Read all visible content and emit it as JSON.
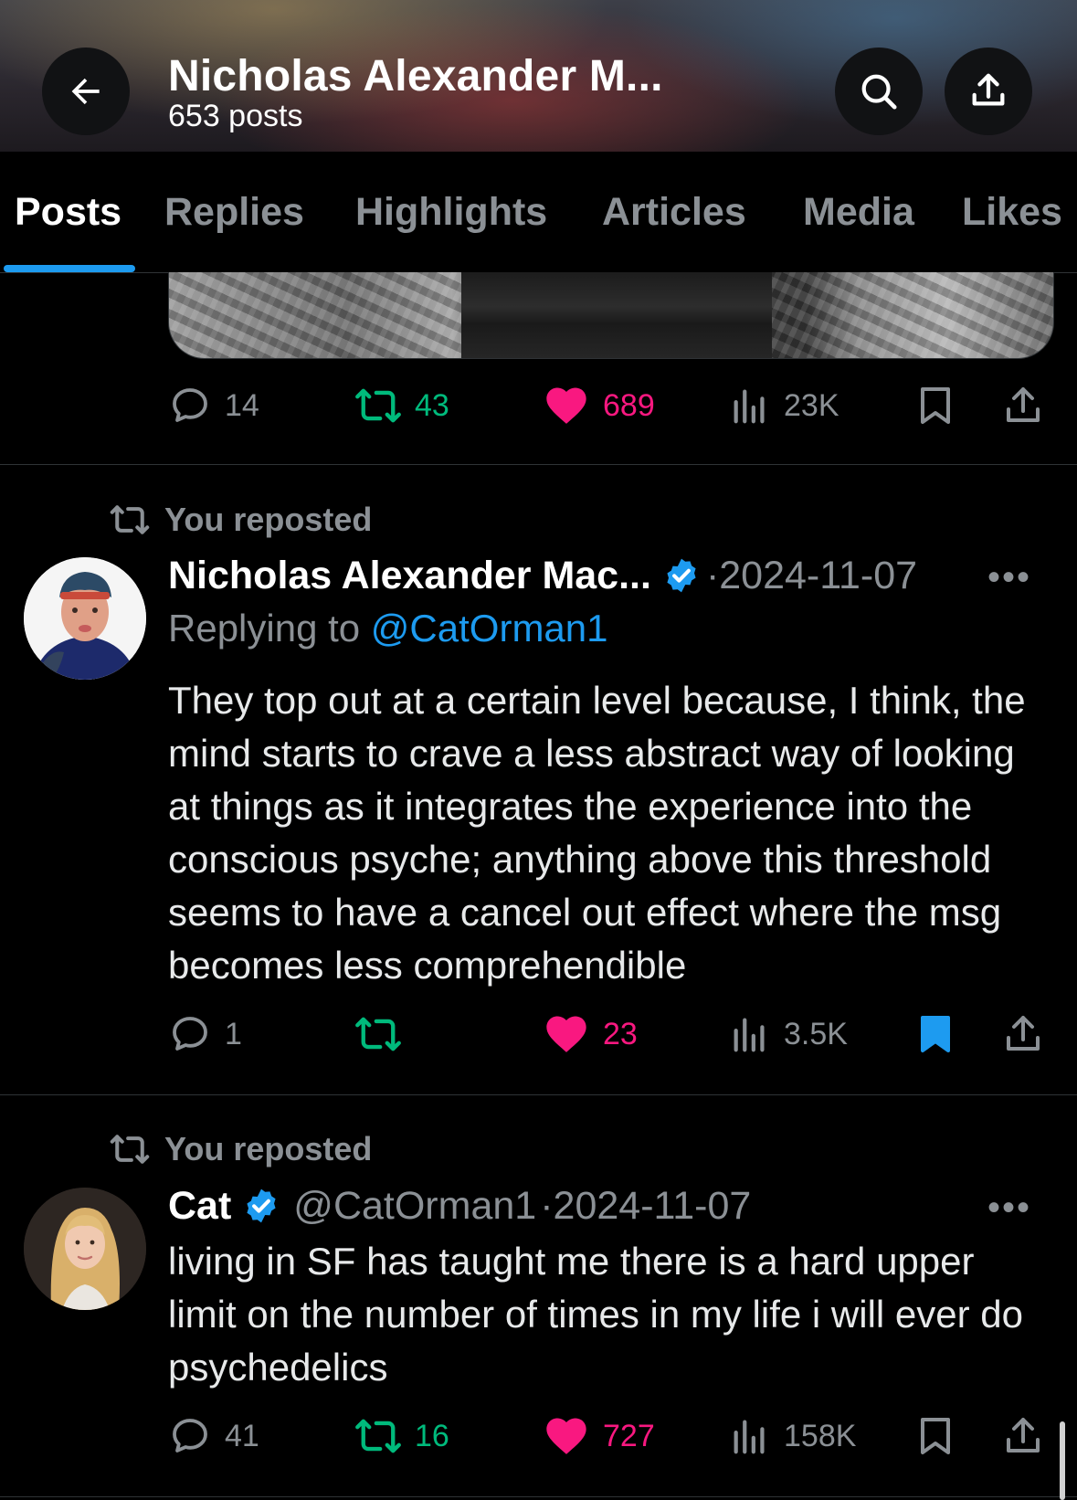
{
  "header": {
    "title": "Nicholas Alexander M...",
    "posts_count": "653 posts",
    "back_icon": "arrow-left-icon",
    "search_icon": "search-icon",
    "share_icon": "share-icon"
  },
  "tabs": [
    {
      "label": "Posts",
      "active": true
    },
    {
      "label": "Replies"
    },
    {
      "label": "Highlights"
    },
    {
      "label": "Articles"
    },
    {
      "label": "Media"
    },
    {
      "label": "Likes"
    }
  ],
  "posts": [
    {
      "replies": "14",
      "reposts": "43",
      "likes": "689",
      "views": "23K",
      "bookmarked": false
    },
    {
      "repost_label": "You reposted",
      "author_name": "Nicholas Alexander Mac...",
      "verified": true,
      "dot": "·",
      "date": "2024-11-07",
      "replying_prefix": "Replying to ",
      "replying_to": "@CatOrman1",
      "text": "They top out at a certain level because, I think, the mind starts to crave a less abstract way of looking at things as it integrates the experience into the conscious psyche; anything above this threshold seems to have a cancel out effect where the msg becomes less comprehendible",
      "replies": "1",
      "reposts": "",
      "likes": "23",
      "views": "3.5K",
      "bookmarked": true
    },
    {
      "repost_label": "You reposted",
      "author_name": "Cat",
      "verified": true,
      "handle": "@CatOrman1",
      "dot": "·",
      "date": "2024-11-07",
      "text": "living in SF has taught me there is a hard upper limit on the number of times in my life i will ever do psychedelics",
      "replies": "41",
      "reposts": "16",
      "likes": "727",
      "views": "158K",
      "bookmarked": false
    }
  ],
  "more_label": "•••",
  "colors": {
    "accent": "#1d9bf0",
    "repost": "#00ba7c",
    "like": "#f91880",
    "muted": "#8b9095"
  }
}
